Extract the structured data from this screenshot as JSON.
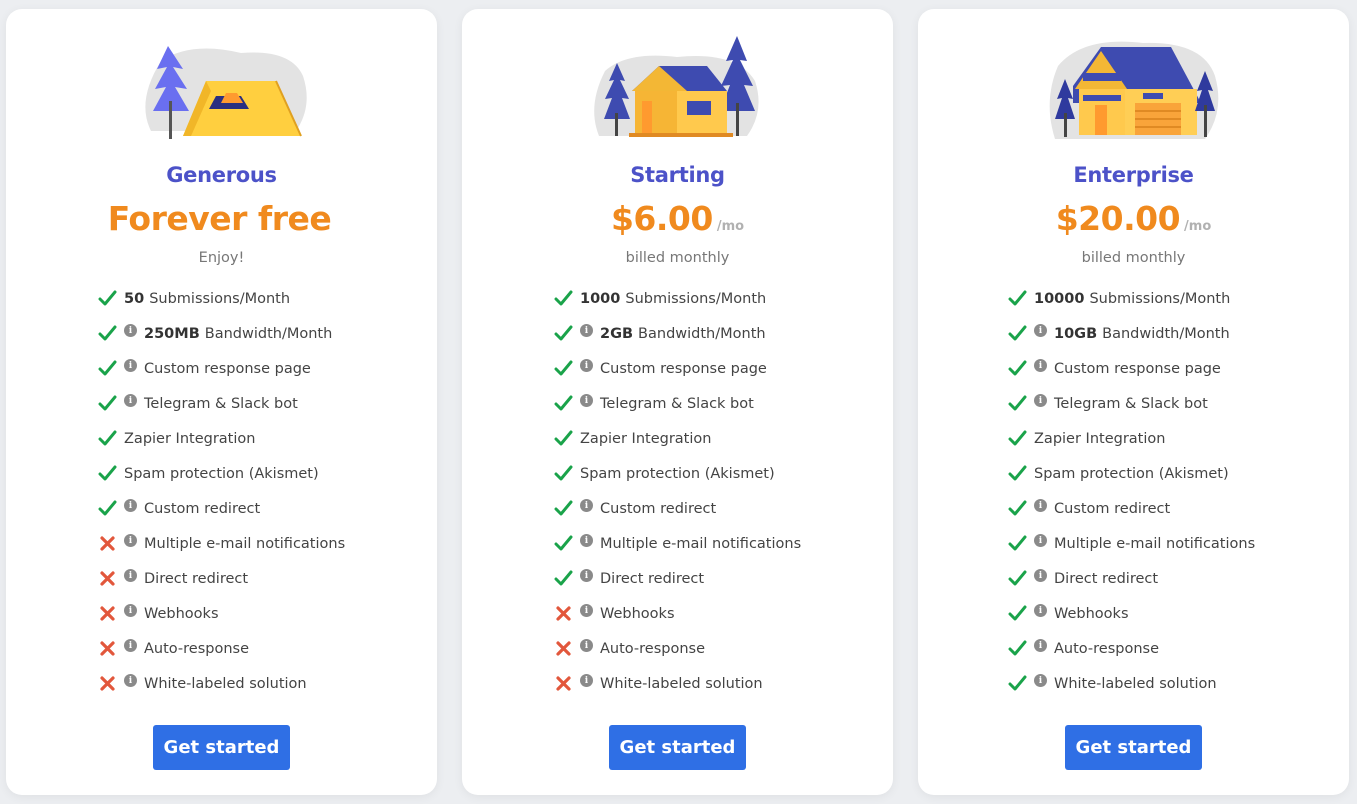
{
  "colors": {
    "accent": "#2f6fe5",
    "tier": "#4c52c8",
    "price": "#f08a1e",
    "check": "#1aa34a",
    "cross": "#e2573c"
  },
  "cta_label": "Get started",
  "plans": [
    {
      "tier": "Generous",
      "price": "Forever free",
      "period": "",
      "subtitle": "Enjoy!",
      "illustration": "tent-icon",
      "features": [
        {
          "included": true,
          "info": false,
          "bold": "50",
          "text": "Submissions/Month"
        },
        {
          "included": true,
          "info": true,
          "bold": "250MB",
          "text": "Bandwidth/Month"
        },
        {
          "included": true,
          "info": true,
          "bold": "",
          "text": "Custom response page"
        },
        {
          "included": true,
          "info": true,
          "bold": "",
          "text": "Telegram & Slack bot"
        },
        {
          "included": true,
          "info": false,
          "bold": "",
          "text": "Zapier Integration"
        },
        {
          "included": true,
          "info": false,
          "bold": "",
          "text": "Spam protection (Akismet)"
        },
        {
          "included": true,
          "info": true,
          "bold": "",
          "text": "Custom redirect"
        },
        {
          "included": false,
          "info": true,
          "bold": "",
          "text": "Multiple e-mail notifications"
        },
        {
          "included": false,
          "info": true,
          "bold": "",
          "text": "Direct redirect"
        },
        {
          "included": false,
          "info": true,
          "bold": "",
          "text": "Webhooks"
        },
        {
          "included": false,
          "info": true,
          "bold": "",
          "text": "Auto-response"
        },
        {
          "included": false,
          "info": true,
          "bold": "",
          "text": "White-labeled solution"
        }
      ]
    },
    {
      "tier": "Starting",
      "price": "$6.00",
      "period": "/mo",
      "subtitle": "billed monthly",
      "illustration": "house-icon",
      "features": [
        {
          "included": true,
          "info": false,
          "bold": "1000",
          "text": "Submissions/Month"
        },
        {
          "included": true,
          "info": true,
          "bold": "2GB",
          "text": "Bandwidth/Month"
        },
        {
          "included": true,
          "info": true,
          "bold": "",
          "text": "Custom response page"
        },
        {
          "included": true,
          "info": true,
          "bold": "",
          "text": "Telegram & Slack bot"
        },
        {
          "included": true,
          "info": false,
          "bold": "",
          "text": "Zapier Integration"
        },
        {
          "included": true,
          "info": false,
          "bold": "",
          "text": "Spam protection (Akismet)"
        },
        {
          "included": true,
          "info": true,
          "bold": "",
          "text": "Custom redirect"
        },
        {
          "included": true,
          "info": true,
          "bold": "",
          "text": "Multiple e-mail notifications"
        },
        {
          "included": true,
          "info": true,
          "bold": "",
          "text": "Direct redirect"
        },
        {
          "included": false,
          "info": true,
          "bold": "",
          "text": "Webhooks"
        },
        {
          "included": false,
          "info": true,
          "bold": "",
          "text": "Auto-response"
        },
        {
          "included": false,
          "info": true,
          "bold": "",
          "text": "White-labeled solution"
        }
      ]
    },
    {
      "tier": "Enterprise",
      "price": "$20.00",
      "period": "/mo",
      "subtitle": "billed monthly",
      "illustration": "building-icon",
      "features": [
        {
          "included": true,
          "info": false,
          "bold": "10000",
          "text": "Submissions/Month"
        },
        {
          "included": true,
          "info": true,
          "bold": "10GB",
          "text": "Bandwidth/Month"
        },
        {
          "included": true,
          "info": true,
          "bold": "",
          "text": "Custom response page"
        },
        {
          "included": true,
          "info": true,
          "bold": "",
          "text": "Telegram & Slack bot"
        },
        {
          "included": true,
          "info": false,
          "bold": "",
          "text": "Zapier Integration"
        },
        {
          "included": true,
          "info": false,
          "bold": "",
          "text": "Spam protection (Akismet)"
        },
        {
          "included": true,
          "info": true,
          "bold": "",
          "text": "Custom redirect"
        },
        {
          "included": true,
          "info": true,
          "bold": "",
          "text": "Multiple e-mail notifications"
        },
        {
          "included": true,
          "info": true,
          "bold": "",
          "text": "Direct redirect"
        },
        {
          "included": true,
          "info": true,
          "bold": "",
          "text": "Webhooks"
        },
        {
          "included": true,
          "info": true,
          "bold": "",
          "text": "Auto-response"
        },
        {
          "included": true,
          "info": true,
          "bold": "",
          "text": "White-labeled solution"
        }
      ]
    }
  ]
}
